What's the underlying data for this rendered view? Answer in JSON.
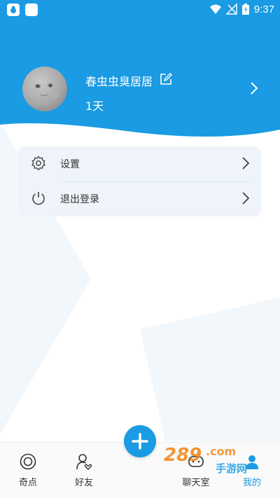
{
  "status_bar": {
    "time": "9:37"
  },
  "profile": {
    "username": "春虫虫臭居居",
    "days": "1天"
  },
  "menu": {
    "items": [
      {
        "label": "设置",
        "icon": "gear-icon"
      },
      {
        "label": "退出登录",
        "icon": "power-icon"
      }
    ]
  },
  "bottom_nav": {
    "items": [
      {
        "label": "奇点",
        "icon": "target-icon",
        "active": false
      },
      {
        "label": "好友",
        "icon": "friend-heart-icon",
        "active": false
      },
      {
        "label": "聊天室",
        "icon": "chat-room-icon",
        "active": false
      },
      {
        "label": "我的",
        "icon": "profile-icon",
        "active": true
      }
    ],
    "fab_icon": "plus-icon"
  },
  "watermark": {
    "text": "289.com 手游网"
  },
  "colors": {
    "primary": "#1a9be3",
    "menu_bg": "#eef4f9",
    "text": "#333333"
  }
}
